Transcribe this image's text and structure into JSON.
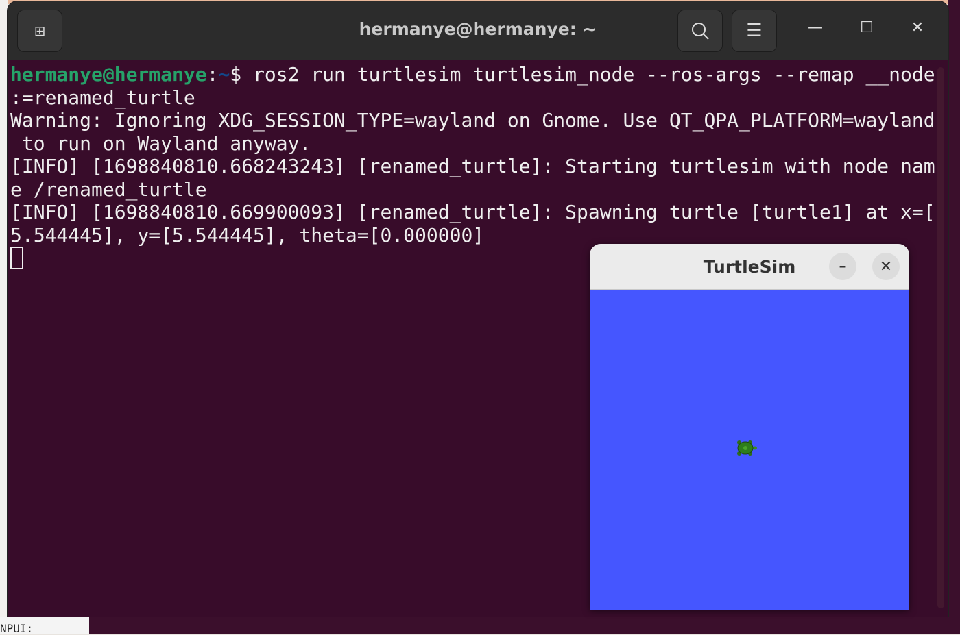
{
  "terminal": {
    "title": "hermanye@hermanye: ~",
    "prompt_user": "hermanye@hermanye",
    "prompt_sep": ":",
    "prompt_path": "~",
    "prompt_symbol": "$ ",
    "lines": [
      "ros2 run turtlesim turtlesim_node --ros-args --remap __node",
      ":=renamed_turtle",
      "Warning: Ignoring XDG_SESSION_TYPE=wayland on Gnome. Use QT_QPA_PLATFORM=wayland",
      " to run on Wayland anyway.",
      "[INFO] [1698840810.668243243] [renamed_turtle]: Starting turtlesim with node nam",
      "e /renamed_turtle",
      "[INFO] [1698840810.669900093] [renamed_turtle]: Spawning turtle [turtle1] at x=[",
      "5.544445], y=[5.544445], theta=[0.000000]"
    ]
  },
  "turtlesim": {
    "title": "TurtleSim",
    "background": "#4556ff"
  },
  "background": {
    "bottom_text": "NPUI:"
  }
}
